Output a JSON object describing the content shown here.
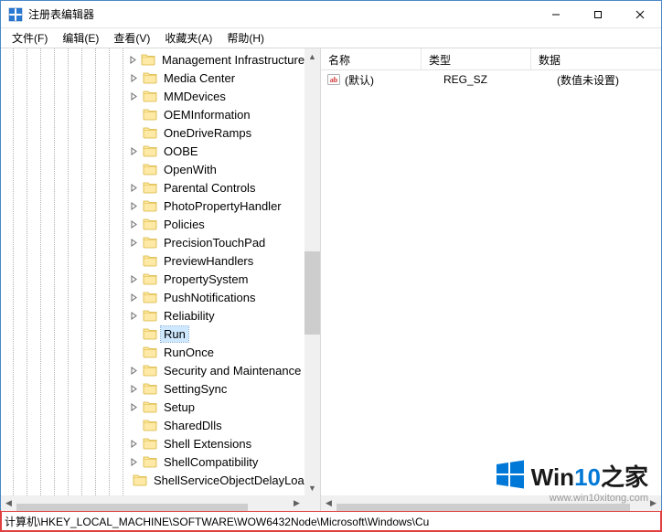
{
  "window": {
    "title": "注册表编辑器"
  },
  "menu": {
    "file": "文件(F)",
    "edit": "编辑(E)",
    "view": "查看(V)",
    "favorites": "收藏夹(A)",
    "help": "帮助(H)"
  },
  "tree": {
    "depth_line_positions": [
      13,
      28,
      43,
      58,
      73,
      88,
      103,
      118,
      133
    ],
    "items": [
      {
        "label": "Management Infrastructure",
        "expandable": true,
        "selected": false
      },
      {
        "label": "Media Center",
        "expandable": true,
        "selected": false
      },
      {
        "label": "MMDevices",
        "expandable": true,
        "selected": false
      },
      {
        "label": "OEMInformation",
        "expandable": false,
        "selected": false
      },
      {
        "label": "OneDriveRamps",
        "expandable": false,
        "selected": false
      },
      {
        "label": "OOBE",
        "expandable": true,
        "selected": false
      },
      {
        "label": "OpenWith",
        "expandable": false,
        "selected": false
      },
      {
        "label": "Parental Controls",
        "expandable": true,
        "selected": false
      },
      {
        "label": "PhotoPropertyHandler",
        "expandable": true,
        "selected": false
      },
      {
        "label": "Policies",
        "expandable": true,
        "selected": false
      },
      {
        "label": "PrecisionTouchPad",
        "expandable": true,
        "selected": false
      },
      {
        "label": "PreviewHandlers",
        "expandable": false,
        "selected": false
      },
      {
        "label": "PropertySystem",
        "expandable": true,
        "selected": false
      },
      {
        "label": "PushNotifications",
        "expandable": true,
        "selected": false
      },
      {
        "label": "Reliability",
        "expandable": true,
        "selected": false
      },
      {
        "label": "Run",
        "expandable": false,
        "selected": true
      },
      {
        "label": "RunOnce",
        "expandable": false,
        "selected": false
      },
      {
        "label": "Security and Maintenance",
        "expandable": true,
        "selected": false
      },
      {
        "label": "SettingSync",
        "expandable": true,
        "selected": false
      },
      {
        "label": "Setup",
        "expandable": true,
        "selected": false
      },
      {
        "label": "SharedDlls",
        "expandable": false,
        "selected": false
      },
      {
        "label": "Shell Extensions",
        "expandable": true,
        "selected": false
      },
      {
        "label": "ShellCompatibility",
        "expandable": true,
        "selected": false
      },
      {
        "label": "ShellServiceObjectDelayLoa",
        "expandable": false,
        "selected": false
      }
    ]
  },
  "list": {
    "columns": {
      "name": "名称",
      "type": "类型",
      "data": "数据"
    },
    "rows": [
      {
        "name": "(默认)",
        "type": "REG_SZ",
        "data": "(数值未设置)"
      }
    ]
  },
  "statusbar": {
    "path": "计算机\\HKEY_LOCAL_MACHINE\\SOFTWARE\\WOW6432Node\\Microsoft\\Windows\\Cu"
  },
  "watermark": {
    "brand_prefix": "Win",
    "brand_suffix": "10",
    "brand_tail": "之家",
    "url": "www.win10xitong.com"
  },
  "icons": {
    "reg_string": "ab"
  }
}
